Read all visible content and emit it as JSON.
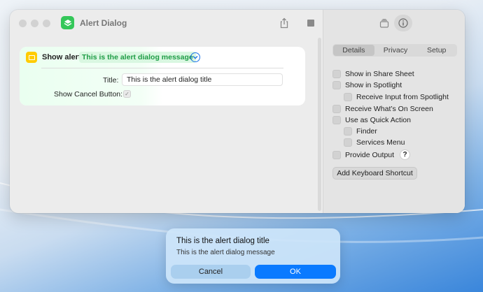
{
  "window": {
    "title": "Alert Dialog"
  },
  "action": {
    "label": "Show alert",
    "message_token": "This is the alert dialog message",
    "title_label": "Title:",
    "title_value": "This is the alert dialog title",
    "cancel_label": "Show Cancel Button:",
    "show_cancel": true
  },
  "sidebar": {
    "tabs": [
      "Details",
      "Privacy",
      "Setup"
    ],
    "active_tab": "Details",
    "options": [
      {
        "label": "Show in Share Sheet",
        "checked": false
      },
      {
        "label": "Show in Spotlight",
        "checked": false
      },
      {
        "label": "Receive Input from Spotlight",
        "checked": false
      },
      {
        "label": "Receive What’s On Screen",
        "checked": false
      },
      {
        "label": "Use as Quick Action",
        "checked": false
      },
      {
        "label": "Finder",
        "checked": false
      },
      {
        "label": "Services Menu",
        "checked": false
      },
      {
        "label": "Provide Output",
        "checked": false
      }
    ],
    "help": "?",
    "keyboard_button": "Add Keyboard Shortcut"
  },
  "alert": {
    "title": "This is the alert dialog title",
    "message": "This is the alert dialog message",
    "cancel": "Cancel",
    "ok": "OK"
  },
  "colors": {
    "accent": "#0a7aff",
    "app_icon": "#34c759",
    "action_icon": "#ffcc00",
    "token_text": "#1f9d46"
  },
  "icons": [
    "shortcuts-app-icon",
    "share-icon",
    "stop-icon",
    "library-icon",
    "info-icon",
    "alert-action-icon",
    "chevron-down-icon"
  ]
}
